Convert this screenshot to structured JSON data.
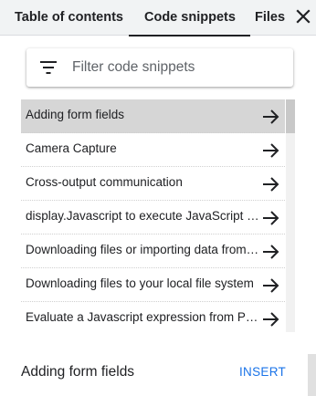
{
  "tabs": [
    {
      "label": "Table of contents",
      "active": false
    },
    {
      "label": "Code snippets",
      "active": true
    },
    {
      "label": "Files",
      "active": false
    }
  ],
  "filter": {
    "placeholder": "Filter code snippets",
    "value": ""
  },
  "snippets": [
    {
      "label": "Adding form fields",
      "selected": true
    },
    {
      "label": "Camera Capture",
      "selected": false
    },
    {
      "label": "Cross-output communication",
      "selected": false
    },
    {
      "label": "display.Javascript to execute JavaScript from Python",
      "selected": false
    },
    {
      "label": "Downloading files or importing data from Google Drive",
      "selected": false
    },
    {
      "label": "Downloading files to your local file system",
      "selected": false
    },
    {
      "label": "Evaluate a Javascript expression from Python",
      "selected": false
    }
  ],
  "preview": {
    "title": "Adding form fields",
    "insert_label": "INSERT"
  },
  "colors": {
    "accent": "#1a73e8",
    "selected_row": "#d6d6d6",
    "tabbar_bg": "#f1f3f4"
  },
  "icons": {
    "close": "close-icon",
    "filter": "filter-icon",
    "arrow": "arrow-right-icon"
  }
}
